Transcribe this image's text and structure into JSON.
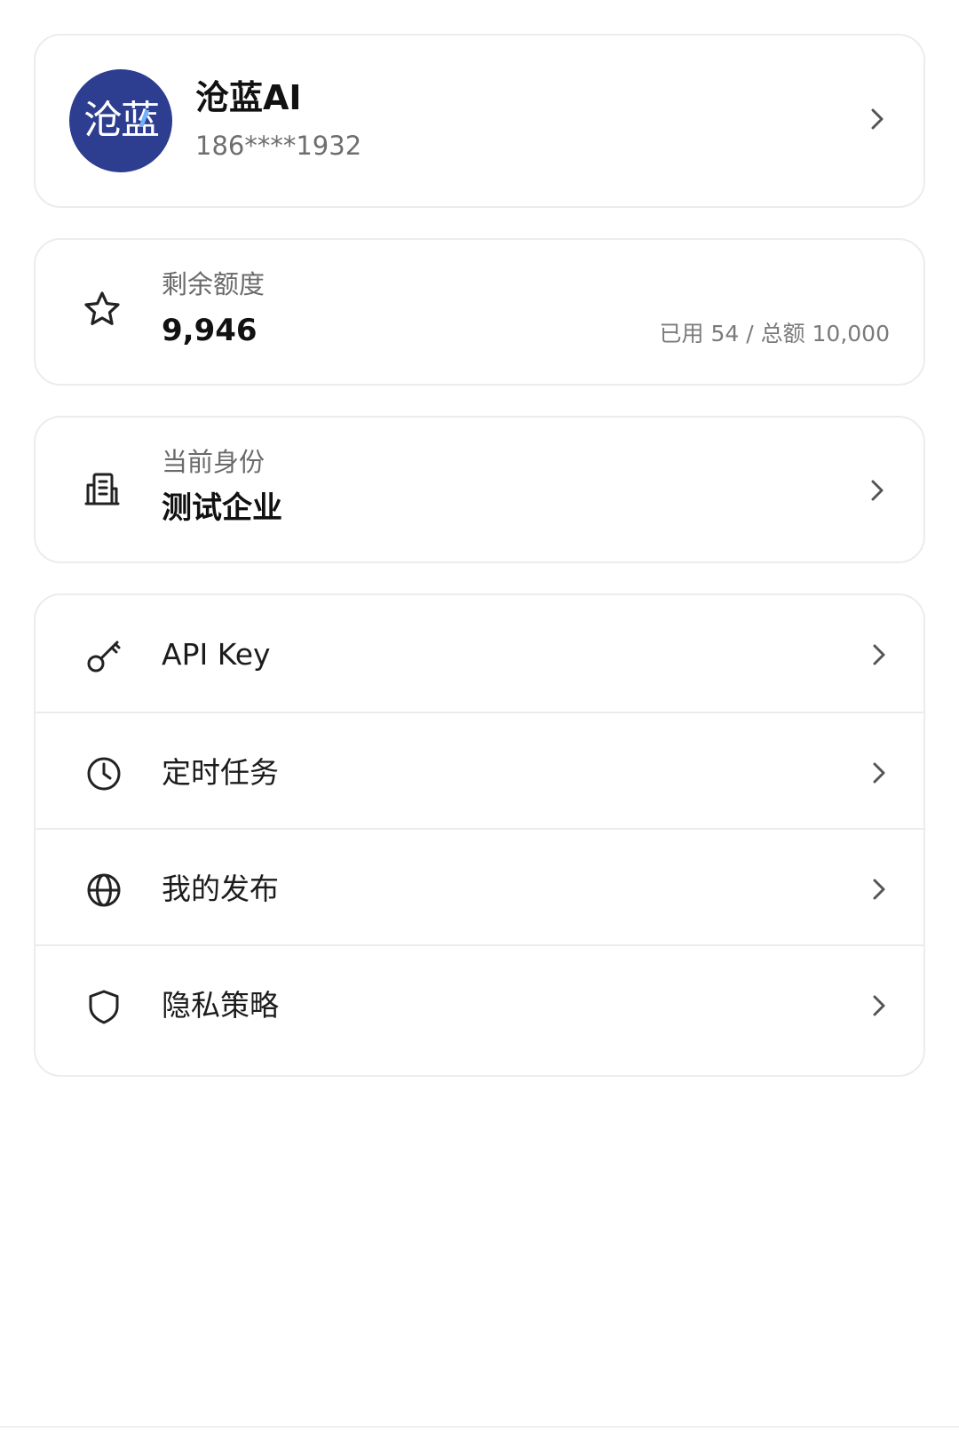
{
  "profile": {
    "avatar_text": "沧蓝",
    "name": "沧蓝AI",
    "phone": "186****1932"
  },
  "quota": {
    "label": "剩余额度",
    "value": "9,946",
    "usage": "已用 54 / 总额 10,000",
    "icon": "star-icon"
  },
  "identity": {
    "label": "当前身份",
    "value": "测试企业",
    "icon": "building-icon"
  },
  "menu": {
    "items": [
      {
        "label": "API Key",
        "icon": "key-icon"
      },
      {
        "label": "定时任务",
        "icon": "clock-icon"
      },
      {
        "label": "我的发布",
        "icon": "globe-icon"
      },
      {
        "label": "隐私策略",
        "icon": "shield-icon"
      }
    ]
  },
  "colors": {
    "avatar_bg": "#2d3d8f",
    "border": "#ececec",
    "text_primary": "#111111",
    "text_secondary": "#6e6e6e"
  }
}
